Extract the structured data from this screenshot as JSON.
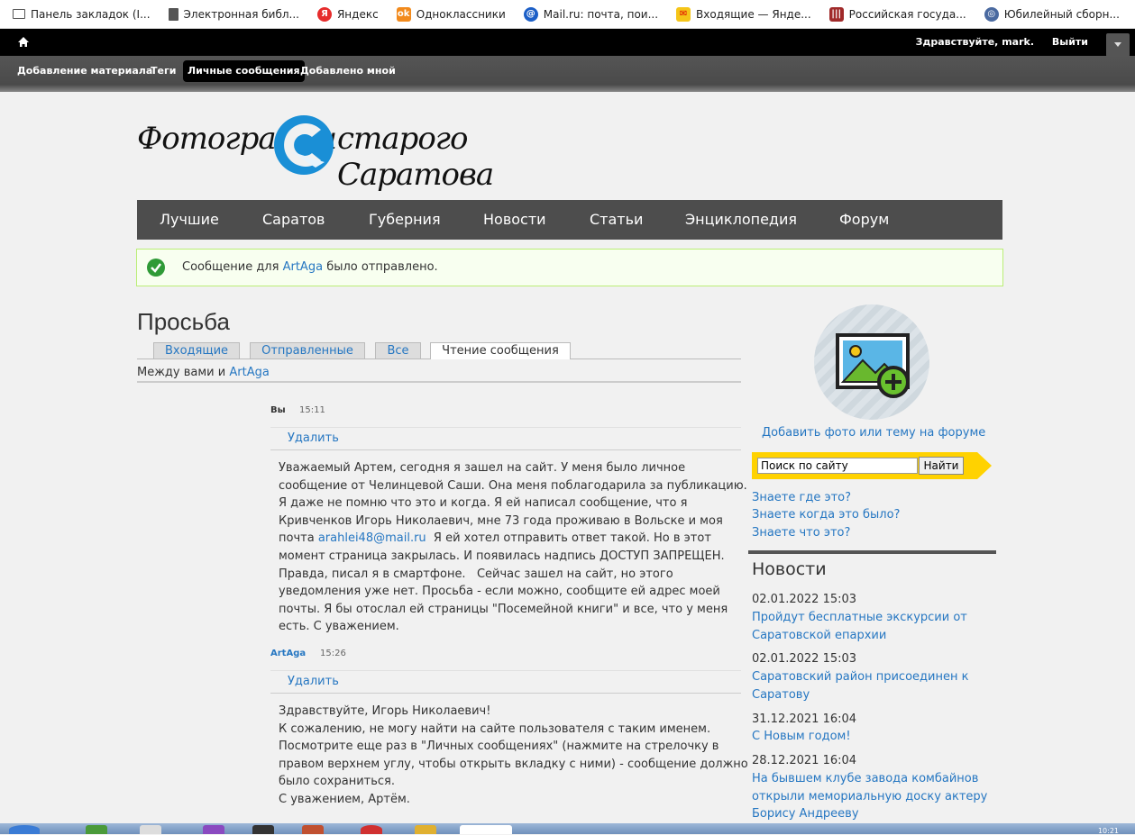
{
  "bookmarks": [
    {
      "label": "Панель закладок (I...",
      "icon": "folder-icon",
      "color": "#555555"
    },
    {
      "label": "Электронная библ...",
      "icon": "page-icon",
      "color": "#555555"
    },
    {
      "label": "Яндекс",
      "icon": "yandex-icon",
      "color": "#e62c2c"
    },
    {
      "label": "Одноклассники",
      "icon": "ok-icon",
      "color": "#f28a1c"
    },
    {
      "label": "Mail.ru: почта, пои...",
      "icon": "mailru-icon",
      "color": "#1c5fc7"
    },
    {
      "label": "Входящие — Яндe...",
      "icon": "yandex-mail-icon",
      "color": "#f5c518"
    },
    {
      "label": "Российская госуда...",
      "icon": "library-icon",
      "color": "#a02a2a"
    },
    {
      "label": "Юбилейный сборн...",
      "icon": "globe-icon",
      "color": "#4a6aa0"
    }
  ],
  "toolbar": {
    "greeting": "Здравствуйте,",
    "user": "mark.",
    "logout": "Выйти"
  },
  "shortcuts": [
    {
      "label": "Добавление материала",
      "active": false
    },
    {
      "label": "Теги",
      "active": false
    },
    {
      "label": "Личные сообщения",
      "active": true
    },
    {
      "label": "Добавлено мной",
      "active": false
    }
  ],
  "logo": {
    "left_text": "Фотографии",
    "right_text": "старого Саратова",
    "accent": "#1a8fd6"
  },
  "nav": [
    "Лучшие",
    "Саратов",
    "Губерния",
    "Новости",
    "Статьи",
    "Энциклопедия",
    "Форум"
  ],
  "status": {
    "prefix": "Сообщение для",
    "user": "ArtAga",
    "suffix": "было отправлено."
  },
  "page": {
    "title": "Просьба",
    "tabs": [
      "Входящие",
      "Отправленные",
      "Все",
      "Чтение сообщения"
    ],
    "between_prefix": "Между вами и",
    "between_user": "ArtAga"
  },
  "messages": [
    {
      "author": "Вы",
      "time": "15:11",
      "delete": "Удалить",
      "lines": [
        "Уважаемый Артем, сегодня я зашел на сайт. У меня было личное",
        "сообщение от Челинцевой Саши. Она меня поблагодарила за публикацию.",
        "Я даже не помню что это и когда. Я ей написал сообщение, что я",
        "Кривченков Игорь Николаевич, мне 73 года проживаю в Вольске и моя",
        "почта ",
        "момент страница закрылась. И появилась надпись ДОСТУП ЗАПРЕЩЕН.",
        "Правда, писал я в смартфоне.   Сейчас зашел на сайт, но этого",
        "уведомления уже нет. Просьба - если можно, сообщите ей адрес моей",
        "почты. Я бы отослал ей страницы \"Посемейной книги\" и все, что у меня",
        "есть. С уважением."
      ],
      "email": "arahlei48@mail.ru",
      "email_after": "  Я ей хотел отправить ответ такой. Но в этот"
    },
    {
      "author": "ArtAga",
      "time": "15:26",
      "delete": "Удалить",
      "lines": [
        "Здравствуйте, Игорь Николаевич!",
        "К сожалению, не могу найти на сайте пользователя с таким именем.",
        "Посмотрите еще раз в \"Личных сообщениях\" (нажмите на стрелочку в",
        "правом верхнем углу, чтобы открыть вкладку с ними) - сообщение должно",
        "было сохраниться.",
        "С уважением, Артём."
      ]
    }
  ],
  "sidebar": {
    "add_photo": "Добавить фото или тему на форуме",
    "search_value": "Поиск по сайту",
    "search_button": "Найти",
    "know_links": [
      "Знаете где это?",
      "Знаете когда это было?",
      "Знаете что это?"
    ],
    "news_title": "Новости",
    "news": [
      {
        "date": "02.01.2022 15:03",
        "title": "Пройдут бесплатные экскурсии от Саратовской епархии"
      },
      {
        "date": "02.01.2022 15:03",
        "title": "Саратовский район присоединен к Саратову"
      },
      {
        "date": "31.12.2021 16:04",
        "title": "С Новым годом!"
      },
      {
        "date": "28.12.2021 16:04",
        "title": "На бывшем клубе завода комбайнов открыли мемориальную доску актеру Борису Андрееву"
      }
    ]
  },
  "taskbar": {
    "clock": "10:21"
  },
  "colors": {
    "link": "#2677c2",
    "nav_bg": "#4d4d4d",
    "search_bg": "#ffd200",
    "success": "#2f9a37"
  }
}
